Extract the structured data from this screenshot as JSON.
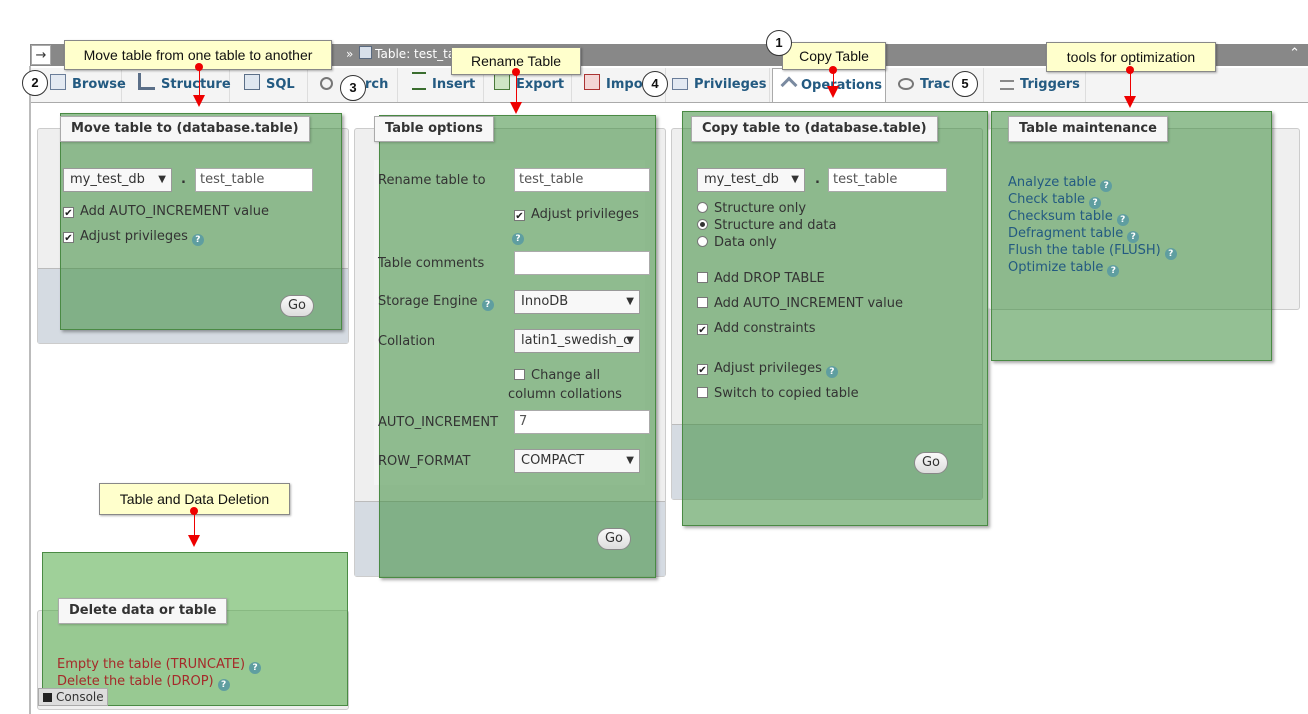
{
  "topbar": {
    "arrow": "→",
    "crumb_prefix": "» ",
    "crumb_table": "Table: test_ta"
  },
  "tabs": [
    {
      "label": "Browse",
      "icon": "browse-icon"
    },
    {
      "label": "Structure",
      "icon": "structure-icon"
    },
    {
      "label": "SQL",
      "icon": "sql-icon"
    },
    {
      "label": "rch",
      "icon": "search-icon"
    },
    {
      "label": "Insert",
      "icon": "insert-icon"
    },
    {
      "label": "Export",
      "icon": "export-icon"
    },
    {
      "label": "Impo",
      "icon": "import-icon"
    },
    {
      "label": "Privileges",
      "icon": "privileges-icon"
    },
    {
      "label": "Operations",
      "icon": "wrench-icon"
    },
    {
      "label": "Trac",
      "icon": "eye-icon"
    },
    {
      "label": "Triggers",
      "icon": "triggers-icon"
    }
  ],
  "move": {
    "legend": "Move table to (database.table)",
    "db": "my_test_db",
    "dot": ".",
    "table": "test_table",
    "opt_auto_inc": "Add AUTO_INCREMENT value",
    "opt_priv": "Adjust privileges",
    "go": "Go"
  },
  "options": {
    "legend": "Table options",
    "rename_label": "Rename table to",
    "rename_value": "test_table",
    "adjust_priv": "Adjust privileges",
    "comments_label": "Table comments",
    "engine_label": "Storage Engine",
    "engine_value": "InnoDB",
    "collation_label": "Collation",
    "collation_value": "latin1_swedish_c",
    "change_all_1": "Change all",
    "change_all_2": "column collations",
    "autoinc_label": "AUTO_INCREMENT",
    "autoinc_value": "7",
    "rowformat_label": "ROW_FORMAT",
    "rowformat_value": "COMPACT",
    "go": "Go"
  },
  "copy": {
    "legend": "Copy table to (database.table)",
    "db": "my_test_db",
    "dot": ".",
    "table": "test_table",
    "r1": "Structure only",
    "r2": "Structure and data",
    "r3": "Data only",
    "c1": "Add DROP TABLE",
    "c2": "Add AUTO_INCREMENT value",
    "c3": "Add constraints",
    "c4": "Adjust privileges",
    "c5": "Switch to copied table",
    "go": "Go"
  },
  "maint": {
    "legend": "Table maintenance",
    "links": [
      "Analyze table",
      "Check table",
      "Checksum table",
      "Defragment table",
      "Flush the table (FLUSH)",
      "Optimize table"
    ]
  },
  "delete": {
    "legend": "Delete data or table",
    "truncate": "Empty the table (TRUNCATE)",
    "drop": "Delete the table (DROP)"
  },
  "console": "Console",
  "callouts": {
    "move": "Move table from one table to another",
    "rename": "Rename Table",
    "copy": "Copy Table",
    "optimize": "tools for optimization",
    "delete": "Table and Data Deletion"
  },
  "numbers": {
    "n1": "1",
    "n2": "2",
    "n3": "3",
    "n4": "4",
    "n5": "5"
  },
  "colors": {
    "overlay": "#50aa46",
    "callout_bg": "#ffffcc",
    "link": "#235a81",
    "danger_link": "#a52a2a",
    "arrow": "#ee0000"
  }
}
